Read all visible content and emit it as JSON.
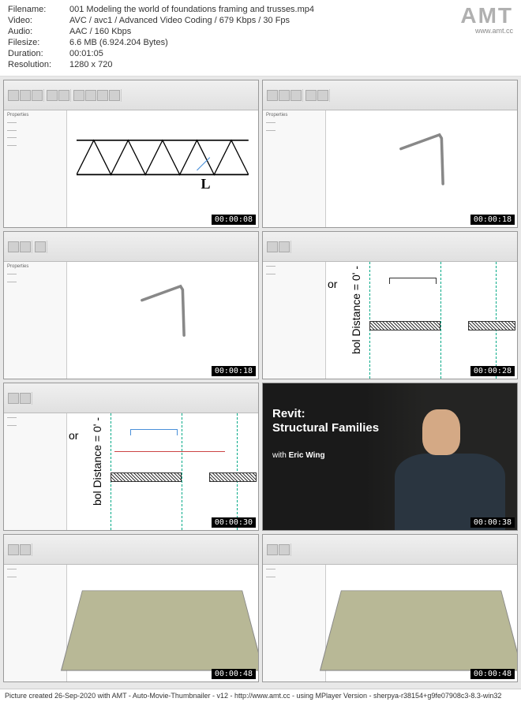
{
  "header": {
    "filename_label": "Filename:",
    "filename": "001 Modeling the world of foundations framing and trusses.mp4",
    "video_label": "Video:",
    "video": "AVC / avc1 / Advanced Video Coding / 679 Kbps / 30 Fps",
    "audio_label": "Audio:",
    "audio": "AAC / 160 Kbps",
    "filesize_label": "Filesize:",
    "filesize": "6.6 MB (6.924.204 Bytes)",
    "duration_label": "Duration:",
    "duration": "00:01:05",
    "resolution_label": "Resolution:",
    "resolution": "1280 x 720"
  },
  "logo": {
    "text": "AMT",
    "url": "www.amt.cc"
  },
  "thumbnails": [
    {
      "timestamp": "00:00:08",
      "type": "truss"
    },
    {
      "timestamp": "00:00:18",
      "type": "angle"
    },
    {
      "timestamp": "00:00:18",
      "type": "angle"
    },
    {
      "timestamp": "00:00:28",
      "type": "plan",
      "text_left": "or",
      "text_vert": "bol Distance = 0' -"
    },
    {
      "timestamp": "00:00:30",
      "type": "plan",
      "text_left": "or",
      "text_vert": "bol Distance = 0' -"
    },
    {
      "timestamp": "00:00:38",
      "type": "title_card"
    },
    {
      "timestamp": "00:00:48",
      "type": "floor"
    },
    {
      "timestamp": "00:00:48",
      "type": "floor"
    }
  ],
  "title_card": {
    "title_line1": "Revit:",
    "title_line2": "Structural Families",
    "author_prefix": "with",
    "author_name": "Eric Wing"
  },
  "footer": "Picture created 26-Sep-2020 with AMT - Auto-Movie-Thumbnailer - v12 - http://www.amt.cc - using MPlayer Version - sherpya-r38154+g9fe07908c3-8.3-win32"
}
